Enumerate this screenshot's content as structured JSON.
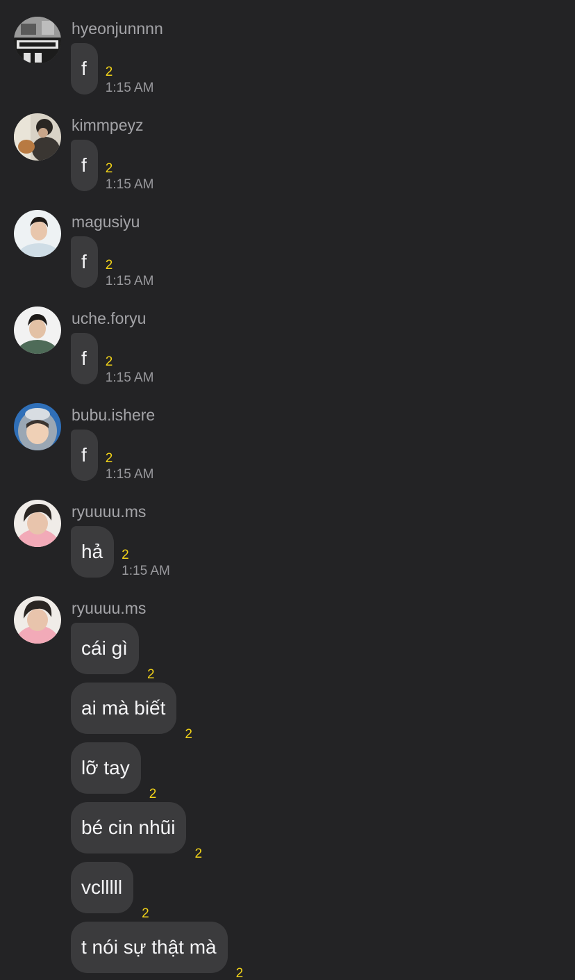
{
  "messages": [
    {
      "username": "hyeonjunnnn",
      "text": "f",
      "count": "2",
      "time": "1:15 AM"
    },
    {
      "username": "kimmpeyz",
      "text": "f",
      "count": "2",
      "time": "1:15 AM"
    },
    {
      "username": "magusiyu",
      "text": "f",
      "count": "2",
      "time": "1:15 AM"
    },
    {
      "username": "uche.foryu",
      "text": "f",
      "count": "2",
      "time": "1:15 AM"
    },
    {
      "username": "bubu.ishere",
      "text": "f",
      "count": "2",
      "time": "1:15 AM"
    },
    {
      "username": "ryuuuu.ms",
      "text": "hả",
      "count": "2",
      "time": "1:15 AM"
    }
  ],
  "last_group": {
    "username": "ryuuuu.ms",
    "messages": [
      {
        "text": "cái gì",
        "count": "2"
      },
      {
        "text": "ai mà biết",
        "count": "2"
      },
      {
        "text": "lỡ tay",
        "count": "2"
      },
      {
        "text": "bé cin nhũi",
        "count": "2"
      },
      {
        "text": "vclllll",
        "count": "2"
      },
      {
        "text": "t nói sự thật mà",
        "count": "2"
      }
    ]
  },
  "colors": {
    "background": "#232325",
    "bubble": "#3b3b3d",
    "count": "#f2d319",
    "username": "#a4a4a8"
  }
}
